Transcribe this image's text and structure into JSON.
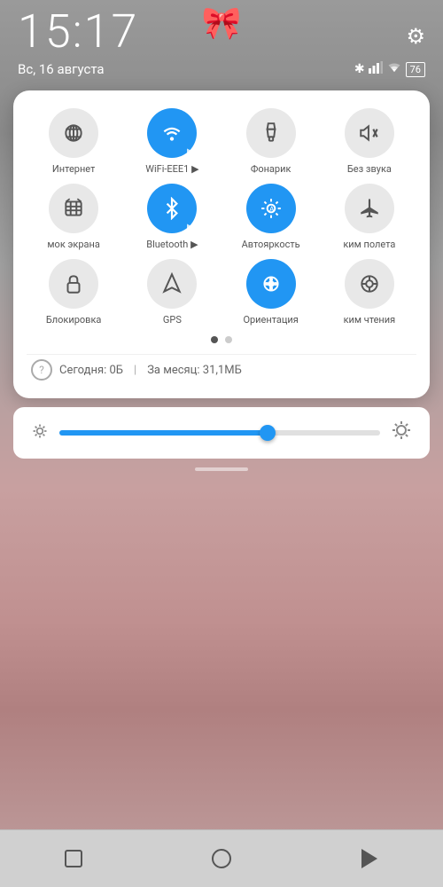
{
  "statusBar": {
    "time": "15:17",
    "date": "Вс, 16 августа",
    "settingsIcon": "⚙",
    "batteryLevel": "76",
    "ribbon": "🎀"
  },
  "quickSettings": {
    "grid": [
      {
        "id": "internet",
        "label": "Интернет",
        "active": false,
        "hasSub": false
      },
      {
        "id": "wifi",
        "label": "WiFi-EEE1",
        "active": true,
        "hasSub": true
      },
      {
        "id": "flashlight",
        "label": "Фонарик",
        "active": false,
        "hasSub": false
      },
      {
        "id": "sound",
        "label": "Без звука",
        "active": false,
        "hasSub": false
      },
      {
        "id": "screenshot",
        "label": "мок экрана",
        "active": false,
        "hasSub": false
      },
      {
        "id": "bluetooth",
        "label": "Bluetooth",
        "active": true,
        "hasSub": true
      },
      {
        "id": "autobrightness",
        "label": "Автояркость",
        "active": true,
        "hasSub": false
      },
      {
        "id": "airplane",
        "label": "ким полета",
        "active": false,
        "hasSub": false
      },
      {
        "id": "lock",
        "label": "Блокировка",
        "active": false,
        "hasSub": false
      },
      {
        "id": "gps",
        "label": "GPS",
        "active": false,
        "hasSub": false
      },
      {
        "id": "orientation",
        "label": "Ориентация",
        "active": true,
        "hasSub": false
      },
      {
        "id": "reading",
        "label": "ким чтения",
        "active": false,
        "hasSub": false
      }
    ],
    "dots": [
      true,
      false
    ],
    "dataUsage": {
      "todayLabel": "Сегодня: 0Б",
      "monthLabel": "За месяц: 31,1МБ",
      "separator": "|"
    }
  },
  "brightness": {
    "fillPercent": 65
  },
  "bottomNav": {
    "square": "□",
    "circle": "○",
    "triangle": "◁"
  }
}
